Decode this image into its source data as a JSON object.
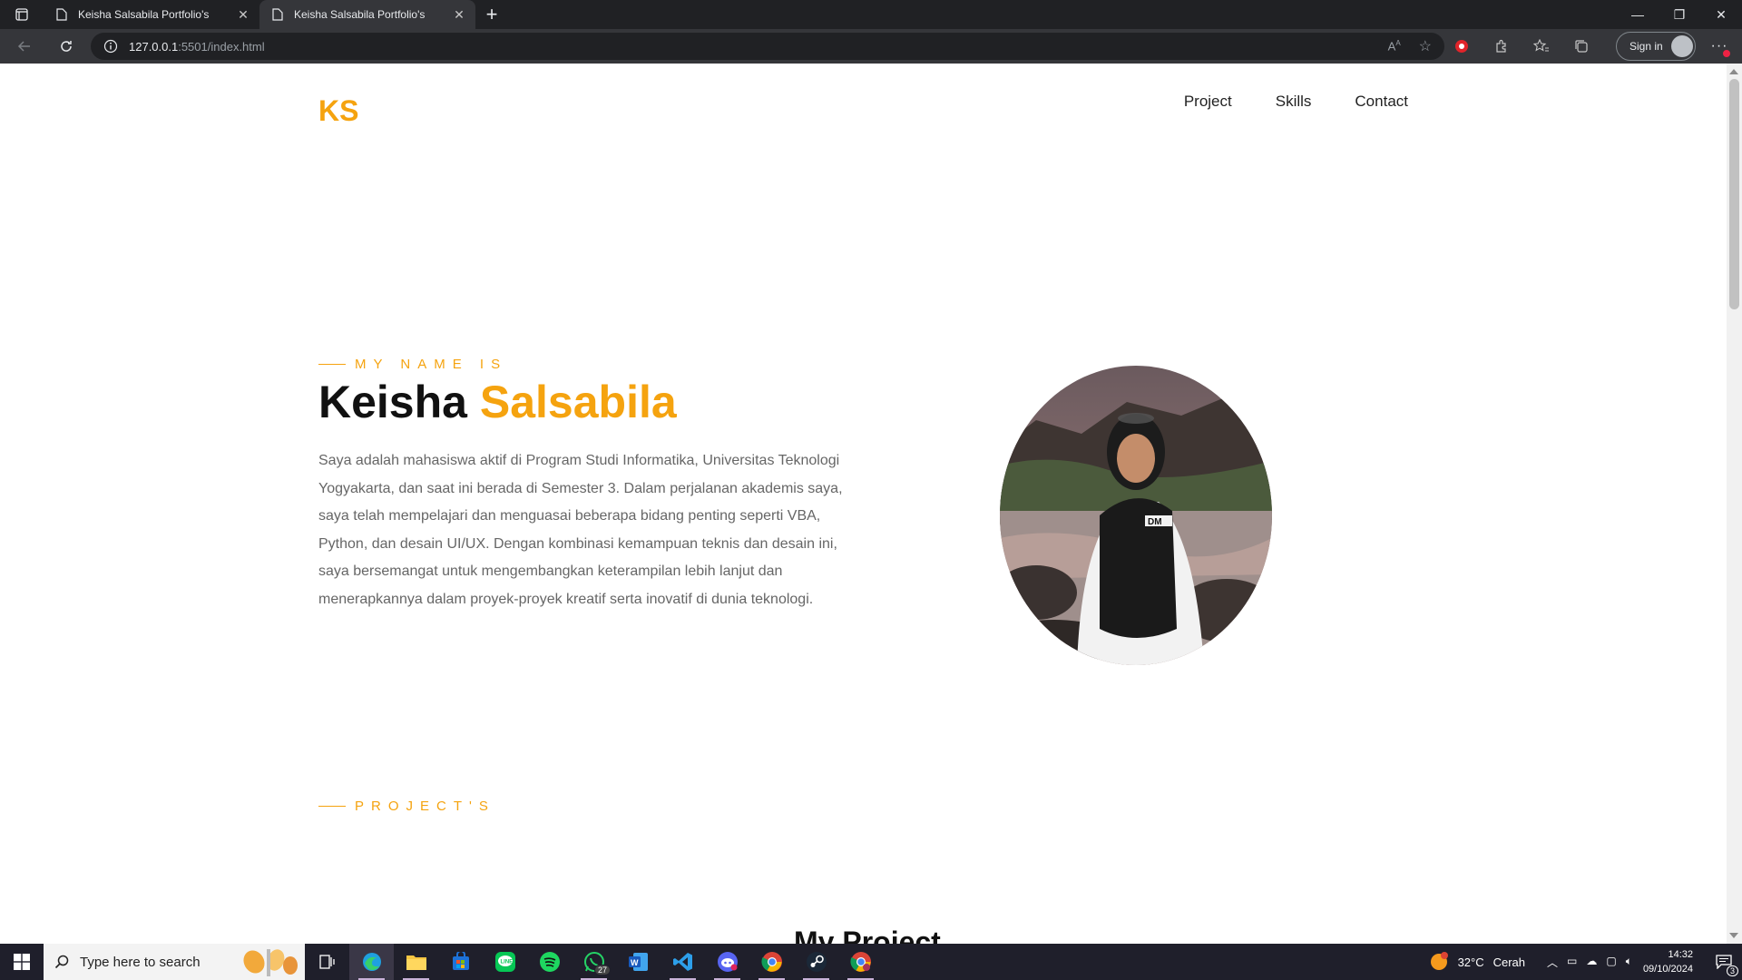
{
  "browser": {
    "tabs": [
      {
        "title": "Keisha Salsabila Portfolio's",
        "active": false
      },
      {
        "title": "Keisha Salsabila Portfolio's",
        "active": true
      }
    ],
    "url_host": "127.0.0.1",
    "url_rest": ":5501/index.html",
    "signin_label": "Sign in"
  },
  "page": {
    "logo": "KS",
    "nav": [
      "Project",
      "Skills",
      "Contact"
    ],
    "hero": {
      "eyebrow": "MY NAME IS",
      "first_name": "Keisha",
      "last_name": "Salsabila",
      "description": "Saya adalah mahasiswa aktif di Program Studi Informatika, Universitas Teknologi Yogyakarta, dan saat ini berada di Semester 3. Dalam perjalanan akademis saya, saya telah mempelajari dan menguasai beberapa bidang penting seperti VBA, Python, dan desain UI/UX. Dengan kombinasi kemampuan teknis dan desain ini, saya bersemangat untuk mengembangkan keterampilan lebih lanjut dan menerapkannya dalam proyek-proyek kreatif serta inovatif di dunia teknologi."
    },
    "projects": {
      "eyebrow": "PROJECT'S",
      "title": "My Project"
    },
    "accent_color": "#f5a30f"
  },
  "taskbar": {
    "search_placeholder": "Type here to search",
    "whatsapp_badge": "27",
    "weather_temp": "32°C",
    "weather_desc": "Cerah",
    "time": "14:32",
    "date": "09/10/2024",
    "notification_count": "3"
  }
}
